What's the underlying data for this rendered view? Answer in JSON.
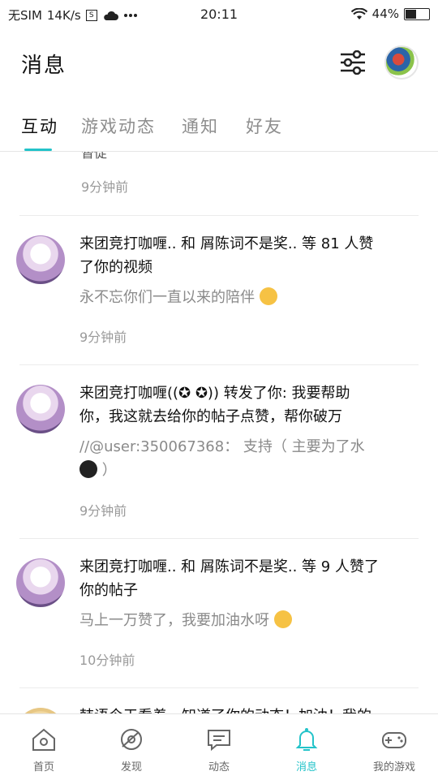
{
  "status_bar": {
    "carrier": "无SIM",
    "speed": "14K/s",
    "s_badge": "S",
    "time": "20:11",
    "battery": "44%"
  },
  "header": {
    "title": "消息"
  },
  "tabs": [
    {
      "label": "互动",
      "active": true
    },
    {
      "label": "游戏动态",
      "active": false
    },
    {
      "label": "通知",
      "active": false
    },
    {
      "label": "好友",
      "active": false
    }
  ],
  "feed": {
    "cut_text": "督促",
    "cut_time": "9分钟前",
    "items": [
      {
        "line1": "来团竞打咖喱.. 和 屑陈词不是奖.. 等 81 人赞",
        "line2": "了你的视频",
        "sub1": "永不忘你们一直以来的陪伴",
        "sub2": "",
        "time": "9分钟前"
      },
      {
        "line1": "来团竞打咖喱((✪ ✪)) 转发了你: 我要帮助",
        "line2": "你，我这就去给你的帖子点赞，帮你破万",
        "sub1": "//@user:350067368： 支持（ 主要为了水",
        "sub2": "）",
        "time": "9分钟前"
      },
      {
        "line1": "来团竞打咖喱.. 和 屑陈词不是奖.. 等 9 人赞了",
        "line2": "你的帖子",
        "sub1": "马上一万赞了，我要加油水呀",
        "sub2": "",
        "time": "10分钟前"
      },
      {
        "line1": "韩语今天看着，知道了你的动态！加油！我的",
        "line2": "",
        "sub1": "",
        "sub2": "",
        "time": ""
      }
    ]
  },
  "bottom_nav": [
    {
      "label": "首页",
      "icon": "home-icon"
    },
    {
      "label": "发现",
      "icon": "discover-icon"
    },
    {
      "label": "动态",
      "icon": "feed-icon"
    },
    {
      "label": "消息",
      "icon": "bell-icon",
      "active": true
    },
    {
      "label": "我的游戏",
      "icon": "gamepad-icon"
    }
  ],
  "colors": {
    "accent": "#23c3c9"
  }
}
